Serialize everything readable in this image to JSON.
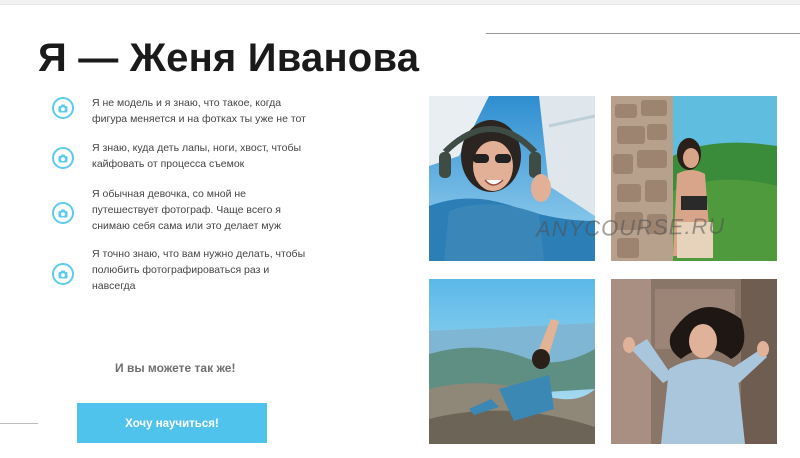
{
  "header": {
    "title": "Я — Женя Иванова"
  },
  "features": [
    {
      "icon": "camera-icon",
      "text": "Я не модель и я знаю, что такое, когда фигура меняется и на фотках ты уже не тот"
    },
    {
      "icon": "camera-icon",
      "text": "Я знаю, куда деть лапы, ноги, хвост, чтобы кайфовать от процесса съемок"
    },
    {
      "icon": "camera-icon",
      "text": "Я обычная девочка, со мной не путешествует фотограф. Чаще всего я снимаю себя сама или это делает муж"
    },
    {
      "icon": "camera-icon",
      "text": "Я точно знаю, что вам нужно делать, чтобы полюбить фотографироваться раз и навсегда"
    }
  ],
  "subtitle": "И вы можете так же!",
  "cta": {
    "label": "Хочу научиться!"
  },
  "watermark": "ANYCOURSE.RU",
  "colors": {
    "accent": "#4fc3ec",
    "icon_ring": "#5ccbed"
  }
}
